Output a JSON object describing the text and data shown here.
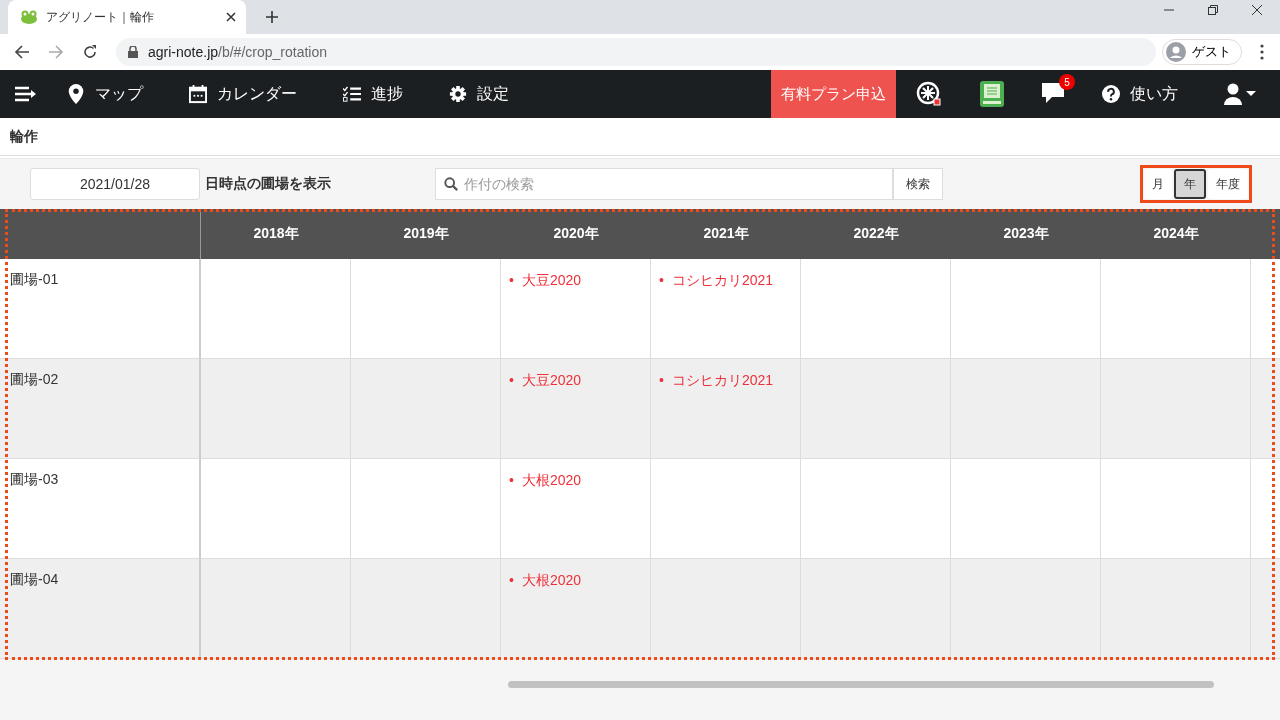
{
  "browser": {
    "tab_title": "アグリノート｜輪作",
    "url_host": "agri-note.jp",
    "url_path": "/b/#/crop_rotation",
    "profile": "ゲスト"
  },
  "nav": {
    "items": [
      {
        "kind": "pin",
        "label": "マップ"
      },
      {
        "kind": "calendar",
        "label": "カレンダー"
      },
      {
        "kind": "list",
        "label": "進捗"
      },
      {
        "kind": "gear",
        "label": "設定"
      }
    ],
    "plan_button": "有料プラン申込",
    "message_count": "5",
    "help": "使い方"
  },
  "page_title": "輪作",
  "toolbar": {
    "date": "2021/01/28",
    "date_caption": "日時点の圃場を表示",
    "search_placeholder": "作付の検索",
    "search_button": "検索",
    "views": [
      {
        "label": "月",
        "selected": false
      },
      {
        "label": "年",
        "selected": true
      },
      {
        "label": "年度",
        "selected": false
      }
    ]
  },
  "table": {
    "columns": [
      "2018年",
      "2019年",
      "2020年",
      "2021年",
      "2022年",
      "2023年",
      "2024年"
    ],
    "rows": [
      {
        "field": "圃場-01",
        "cells": [
          {},
          {},
          {
            "bullet": "•",
            "crop": "大豆2020"
          },
          {
            "bullet": "•",
            "crop": "コシヒカリ2021"
          },
          {},
          {},
          {}
        ]
      },
      {
        "field": "圃場-02",
        "cells": [
          {},
          {},
          {
            "bullet": "•",
            "crop": "大豆2020"
          },
          {
            "bullet": "•",
            "crop": "コシヒカリ2021"
          },
          {},
          {},
          {}
        ]
      },
      {
        "field": "圃場-03",
        "cells": [
          {},
          {},
          {
            "bullet": "•",
            "crop": "大根2020"
          },
          {},
          {},
          {},
          {}
        ]
      },
      {
        "field": "圃場-04",
        "cells": [
          {},
          {},
          {
            "bullet": "•",
            "crop": "大根2020"
          },
          {},
          {},
          {},
          {}
        ]
      }
    ]
  }
}
